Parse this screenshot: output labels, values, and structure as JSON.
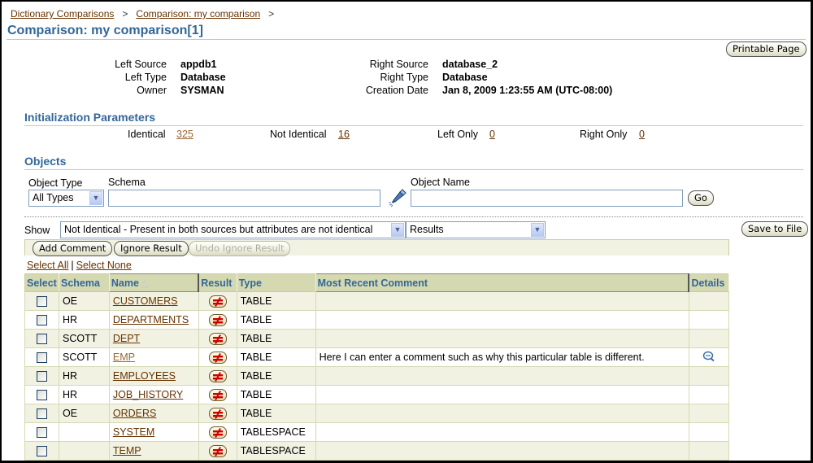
{
  "breadcrumb": [
    {
      "label": "Dictionary Comparisons"
    },
    {
      "label": "Comparison: my comparison"
    }
  ],
  "breadcrumb_separator": ">",
  "page_title": "Comparison: my comparison[1]",
  "printable_page_label": "Printable Page",
  "summary": {
    "left_source_label": "Left Source",
    "left_source": "appdb1",
    "left_type_label": "Left Type",
    "left_type": "Database",
    "owner_label": "Owner",
    "owner": "SYSMAN",
    "right_source_label": "Right Source",
    "right_source": "database_2",
    "right_type_label": "Right Type",
    "right_type": "Database",
    "creation_date_label": "Creation Date",
    "creation_date": "Jan 8, 2009 1:23:55 AM (UTC-08:00)"
  },
  "init_params": {
    "heading": "Initialization Parameters",
    "identical_label": "Identical",
    "identical": "325",
    "not_identical_label": "Not Identical",
    "not_identical": "16",
    "left_only_label": "Left Only",
    "left_only": "0",
    "right_only_label": "Right Only",
    "right_only": "0"
  },
  "objects": {
    "heading": "Objects",
    "object_type_label": "Object Type",
    "object_type_value": "All Types",
    "schema_label": "Schema",
    "schema_value": "",
    "object_name_label": "Object Name",
    "object_name_value": "",
    "go_label": "Go"
  },
  "show": {
    "label": "Show",
    "filter_value": "Not Identical - Present in both sources but attributes are not identical",
    "view_value": "Results",
    "save_to_file_label": "Save to File"
  },
  "actions": {
    "add_comment": "Add Comment",
    "ignore_result": "Ignore Result",
    "undo_ignore_result": "Undo Ignore Result",
    "select_all": "Select All",
    "select_none": "Select None",
    "divider": "|"
  },
  "table": {
    "columns": [
      "Select",
      "Schema",
      "Name",
      "Result",
      "Type",
      "Most Recent Comment",
      "Details"
    ],
    "sort_indicator": "△",
    "rows": [
      {
        "schema": "OE",
        "name": "CUSTOMERS",
        "result": "not-equal",
        "type": "TABLE",
        "comment": "",
        "details": false
      },
      {
        "schema": "HR",
        "name": "DEPARTMENTS",
        "result": "not-equal",
        "type": "TABLE",
        "comment": "",
        "details": false
      },
      {
        "schema": "SCOTT",
        "name": "DEPT",
        "result": "not-equal",
        "type": "TABLE",
        "comment": "",
        "details": false
      },
      {
        "schema": "SCOTT",
        "name": "EMP",
        "result": "not-equal",
        "type": "TABLE",
        "comment": "Here I can enter a comment such as why this particular table is different.",
        "details": true
      },
      {
        "schema": "HR",
        "name": "EMPLOYEES",
        "result": "not-equal",
        "type": "TABLE",
        "comment": "",
        "details": false
      },
      {
        "schema": "HR",
        "name": "JOB_HISTORY",
        "result": "not-equal",
        "type": "TABLE",
        "comment": "",
        "details": false
      },
      {
        "schema": "OE",
        "name": "ORDERS",
        "result": "not-equal",
        "type": "TABLE",
        "comment": "",
        "details": false
      },
      {
        "schema": "",
        "name": "SYSTEM",
        "result": "not-equal",
        "type": "TABLESPACE",
        "comment": "",
        "details": false
      },
      {
        "schema": "",
        "name": "TEMP",
        "result": "not-equal",
        "type": "TABLESPACE",
        "comment": "",
        "details": false
      }
    ]
  },
  "colors": {
    "heading_blue": "#336699",
    "link_brown": "#663300",
    "header_bg": "#d5d9b1",
    "row_alt_bg": "#f2f2e2",
    "not_equal_red": "#cc0000"
  }
}
